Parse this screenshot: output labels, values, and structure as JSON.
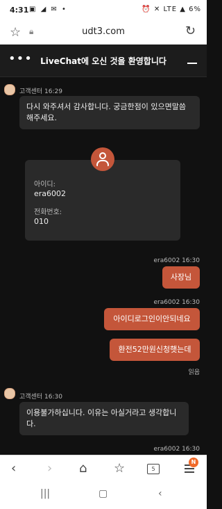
{
  "status": {
    "time": "4:31",
    "battery": "6%",
    "network": "LTE"
  },
  "browser": {
    "url": "udt3.com"
  },
  "chat": {
    "title": "LiveChat에 오신 것을 환영합니다",
    "messages": [
      {
        "sender": "고객센터",
        "time": "16:29",
        "text": "다시 와주셔서 감사합니다. 궁금한점이 있으면말씀해주세요."
      },
      {
        "sender": "era6002",
        "time": "16:30",
        "text": "사장님"
      },
      {
        "sender": "era6002",
        "time": "16:30",
        "text": "아이디로그인이안되네요"
      },
      {
        "sender": "era6002",
        "time": "16:30",
        "text": "환전52만원신청햇는데"
      },
      {
        "sender": "고객센터",
        "time": "16:30",
        "text": "이용불가하십니다. 이유는 아실거라고 생각합니다."
      },
      {
        "sender": "era6002",
        "time": "16:30",
        "text": ""
      }
    ],
    "read_label": "읽음",
    "card": {
      "id_label": "아이디:",
      "id_value": "era6002",
      "phone_label": "전화번호:",
      "phone_value": "010"
    }
  },
  "nav": {
    "tabs_count": "5",
    "menu_badge": "N"
  }
}
